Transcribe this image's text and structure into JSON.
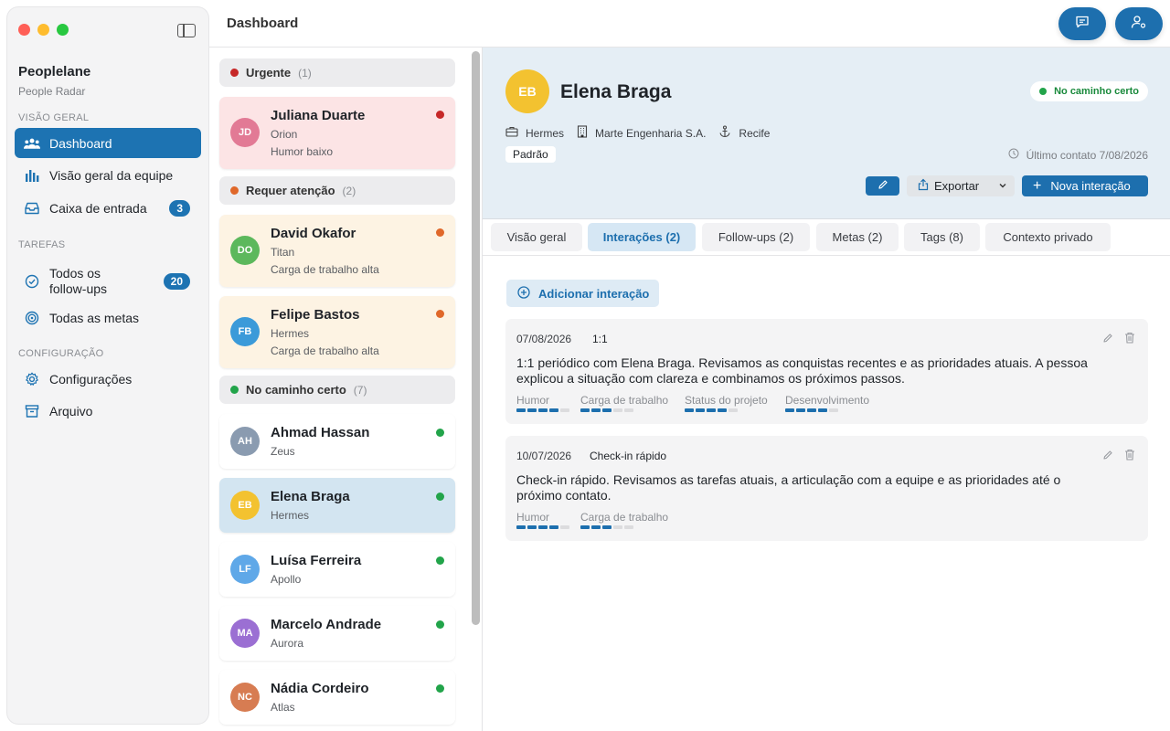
{
  "app": {
    "name": "Peoplelane",
    "subtitle": "People Radar",
    "page_title": "Dashboard"
  },
  "sidebar": {
    "sections": {
      "overview": "VISÃO GERAL",
      "tasks": "TAREFAS",
      "config": "CONFIGURAÇÃO"
    },
    "items": [
      {
        "label": "Dashboard",
        "icon": "people-icon",
        "active": true
      },
      {
        "label": "Visão geral da equipe",
        "icon": "bar-chart-icon"
      },
      {
        "label": "Caixa de entrada",
        "icon": "inbox-icon",
        "badge": "3"
      },
      {
        "label": "Todos os follow-ups",
        "icon": "check-circle-icon",
        "badge": "20"
      },
      {
        "label": "Todas as metas",
        "icon": "target-icon"
      },
      {
        "label": "Configurações",
        "icon": "gear-icon"
      },
      {
        "label": "Arquivo",
        "icon": "archive-icon"
      }
    ]
  },
  "colors": {
    "accent": "#1d73b2",
    "urgent": "#c62828",
    "attention": "#e0682a",
    "ontrack": "#22a44a"
  },
  "groups": {
    "urgent": {
      "label": "Urgente",
      "count": "(1)"
    },
    "attention": {
      "label": "Requer atenção",
      "count": "(2)"
    },
    "ontrack": {
      "label": "No caminho certo",
      "count": "(7)"
    }
  },
  "people": [
    {
      "initials": "JD",
      "name": "Juliana Duarte",
      "team": "Orion",
      "note": "Humor baixo"
    },
    {
      "initials": "DO",
      "name": "David Okafor",
      "team": "Titan",
      "note": "Carga de trabalho alta"
    },
    {
      "initials": "FB",
      "name": "Felipe Bastos",
      "team": "Hermes",
      "note": "Carga de trabalho alta"
    },
    {
      "initials": "AH",
      "name": "Ahmad Hassan",
      "team": "Zeus"
    },
    {
      "initials": "EB",
      "name": "Elena Braga",
      "team": "Hermes"
    },
    {
      "initials": "LF",
      "name": "Luísa Ferreira",
      "team": "Apollo"
    },
    {
      "initials": "MA",
      "name": "Marcelo Andrade",
      "team": "Aurora"
    },
    {
      "initials": "NC",
      "name": "Nádia Cordeiro",
      "team": "Atlas"
    }
  ],
  "detail": {
    "initials": "EB",
    "name": "Elena Braga",
    "status": "No caminho certo",
    "team": "Hermes",
    "company": "Marte Engenharia S.A.",
    "city": "Recife",
    "tag": "Padrão",
    "last_contact": "Último contato 7/08/2026",
    "export_label": "Exportar",
    "new_interaction_label": "Nova interação",
    "tabs": [
      {
        "label": "Visão geral"
      },
      {
        "label": "Interações (2)",
        "active": true
      },
      {
        "label": "Follow-ups (2)"
      },
      {
        "label": "Metas (2)"
      },
      {
        "label": "Tags (8)"
      },
      {
        "label": "Contexto privado"
      }
    ],
    "add_interaction_label": "Adicionar interação",
    "interactions": [
      {
        "date": "07/08/2026",
        "type": "1:1",
        "text": "1:1 periódico com Elena Braga. Revisamos as conquistas recentes e as prioridades atuais. A pessoa explicou a situação com clareza e combinamos os próximos passos.",
        "metrics": [
          {
            "label": "Humor",
            "level": 4,
            "max": 5
          },
          {
            "label": "Carga de trabalho",
            "level": 3,
            "max": 5
          },
          {
            "label": "Status do projeto",
            "level": 4,
            "max": 5
          },
          {
            "label": "Desenvolvimento",
            "level": 4,
            "max": 5
          }
        ]
      },
      {
        "date": "10/07/2026",
        "type": "Check-in rápido",
        "text": "Check-in rápido. Revisamos as tarefas atuais, a articulação com a equipe e as prioridades até o próximo contato.",
        "metrics": [
          {
            "label": "Humor",
            "level": 4,
            "max": 5
          },
          {
            "label": "Carga de trabalho",
            "level": 3,
            "max": 5
          }
        ]
      }
    ]
  }
}
